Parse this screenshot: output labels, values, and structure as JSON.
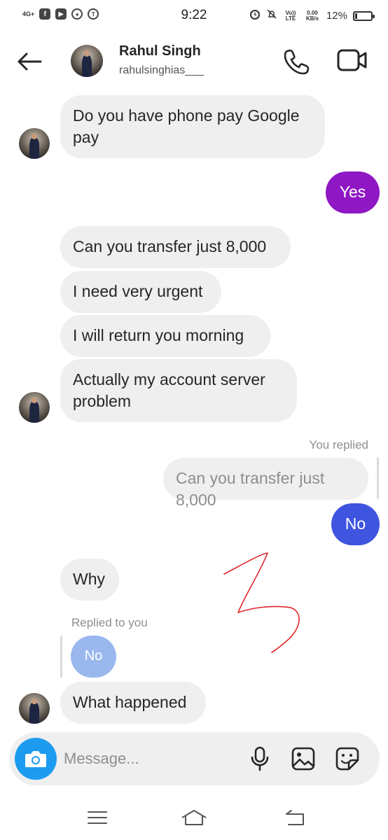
{
  "status_bar": {
    "network": "4G+",
    "time": "9:22",
    "volte": "Vo)) LTE",
    "speed": "0.00 KB/s",
    "battery_percent": "12%",
    "battery_level": 0.12,
    "icons": [
      "facebook-icon",
      "youtube-icon",
      "chrome-icon",
      "app-icon",
      "alarm-icon",
      "mute-icon"
    ]
  },
  "header": {
    "name": "Rahul Singh",
    "username": "rahulsinghias___",
    "icons": {
      "back": "arrow-left-icon",
      "call": "phone-icon",
      "video": "video-camera-icon"
    }
  },
  "messages": [
    {
      "id": "m1",
      "direction": "incoming",
      "text": "Do you have phone pay Google pay"
    },
    {
      "id": "m2",
      "direction": "outgoing",
      "text": "Yes",
      "color": "#8f17c4"
    },
    {
      "id": "m3",
      "direction": "incoming",
      "text": "Can you transfer just 8,000"
    },
    {
      "id": "m4",
      "direction": "incoming",
      "text": "I need very urgent"
    },
    {
      "id": "m5",
      "direction": "incoming",
      "text": "I will return you morning"
    },
    {
      "id": "m6",
      "direction": "incoming",
      "text": "Actually my account server problem"
    },
    {
      "id": "m7",
      "direction": "outgoing",
      "reply_label": "You replied",
      "replied_text": "Can you transfer just 8,000",
      "text": "No",
      "color": "#3f55e0"
    },
    {
      "id": "m8",
      "direction": "incoming",
      "text": "Why"
    },
    {
      "id": "m9",
      "direction": "incoming",
      "reply_label": "Replied to you",
      "replied_text": "No"
    },
    {
      "id": "m10",
      "direction": "incoming",
      "text": "What happened"
    }
  ],
  "composer": {
    "placeholder": "Message...",
    "value": "",
    "icons": {
      "camera": "camera-icon",
      "mic": "microphone-icon",
      "gallery": "image-icon",
      "sticker": "sticker-icon"
    }
  },
  "nav_bar": {
    "icons": {
      "menu": "menu-icon",
      "home": "home-icon",
      "back": "back-icon"
    }
  },
  "annotation": {
    "type": "red-scribble",
    "color": "#e0262b"
  },
  "colors": {
    "accent_blue": "#1d9bf0",
    "bubble_gray": "#efefef"
  }
}
